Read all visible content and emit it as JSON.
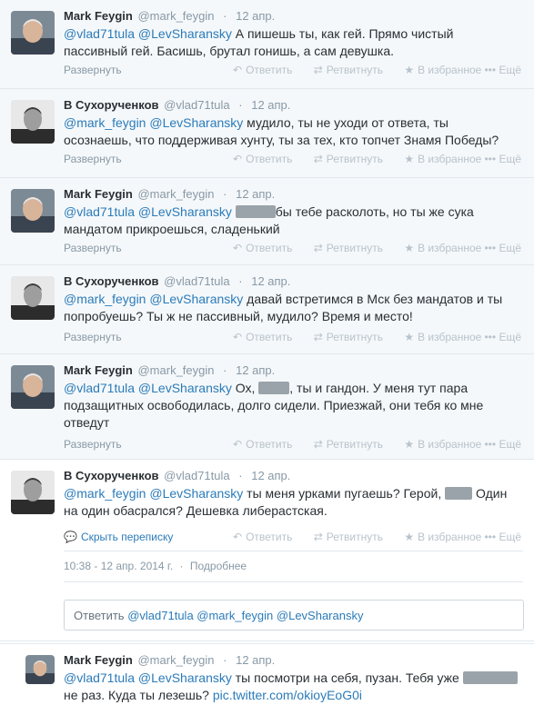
{
  "labels": {
    "expand": "Развернуть",
    "reply": "Ответить",
    "retweet": "Ретвитнуть",
    "favorite": "В избранное",
    "more": "Ещё",
    "hide_conversation": "Скрыть переписку",
    "details": "Подробнее"
  },
  "icons": {
    "reply": "reply-arrow-icon",
    "retweet": "retweet-icon",
    "favorite": "star-icon",
    "conversation": "speech-bubble-icon"
  },
  "colors": {
    "link": "#2b7bb9",
    "muted": "#8899a6",
    "action": "#b8c3cc",
    "grey_bg": "#f5f8fa"
  },
  "tweets": [
    {
      "name": "Mark Feygin",
      "handle": "@mark_feygin",
      "date": "12 апр.",
      "mentions": "@vlad71tula @LevSharansky",
      "text": " А пишешь ты, как гей. Прямо чистый пассивный гей. Басишь, брутал гонишь, а сам девушка."
    },
    {
      "name": "В Сухорученков",
      "handle": "@vlad71tula",
      "date": "12 апр.",
      "mentions": "@mark_feygin @LevSharansky",
      "text": " мудило, ты не уходи от ответа, ты осознаешь, что поддерживая хунту, ты за тех, кто топчет Знамя Победы?"
    },
    {
      "name": "Mark Feygin",
      "handle": "@mark_feygin",
      "date": "12 апр.",
      "mentions": "@vlad71tula @LevSharansky",
      "text_a": " ",
      "text_b": "бы тебе расколоть, но ты же сука мандатом прикроешься, сладенький"
    },
    {
      "name": "В Сухорученков",
      "handle": "@vlad71tula",
      "date": "12 апр.",
      "mentions": "@mark_feygin @LevSharansky",
      "text": " давай встретимся в Мск без мандатов и ты попробуешь? Ты ж не пассивный, мудило? Время и место!"
    },
    {
      "name": "Mark Feygin",
      "handle": "@mark_feygin",
      "date": "12 апр.",
      "mentions": "@vlad71tula @LevSharansky",
      "text_a": " Ох, ",
      "text_b": ", ты и гандон. У меня тут пара подзащитных освободилась, долго сидели. Приезжай, они тебя ко мне отведут"
    },
    {
      "name": "В Сухорученков",
      "handle": "@vlad71tula",
      "date": "12 апр.",
      "mentions": "@mark_feygin @LevSharansky",
      "text_a": " ты меня урками пугаешь? Герой, ",
      "text_b": " Один на один обасрался? Дешевка либерастская.",
      "timestamp": "10:38 - 12 апр. 2014 г."
    }
  ],
  "reply_box": {
    "prefix": "Ответить",
    "mentions": "@vlad71tula @mark_feygin @LevSharansky"
  },
  "last_tweet": {
    "name": "Mark Feygin",
    "handle": "@mark_feygin",
    "date": "12 апр.",
    "mentions": "@vlad71tula @LevSharansky",
    "text_a": " ты посмотри на себя, пузан. Тебя уже ",
    "text_b": " не раз. Куда ты лезешь? ",
    "link": "pic.twitter.com/okioyEoG0i"
  }
}
